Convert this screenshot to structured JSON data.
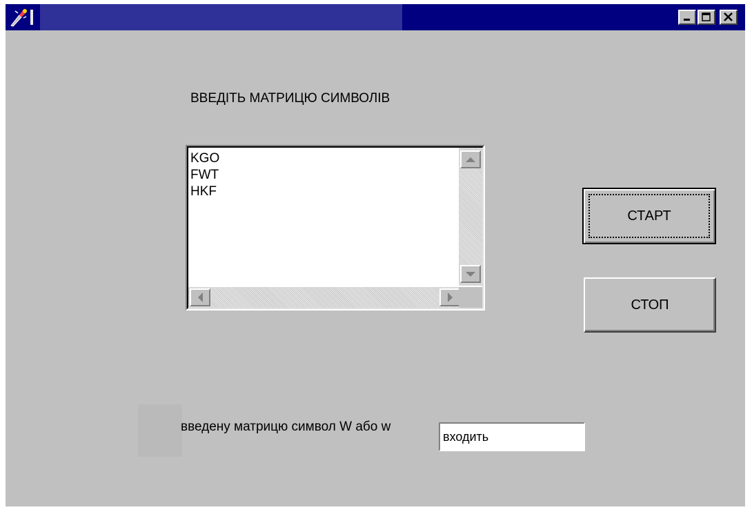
{
  "window": {
    "title": "",
    "controls": {
      "minimize_icon": "minimize-icon",
      "maximize_icon": "maximize-icon",
      "close_icon": "close-icon"
    },
    "colors": {
      "titlebar": "#000080",
      "face": "#c0c0c0"
    }
  },
  "main": {
    "prompt": "ВВЕДІТЬ МАТРИЦЮ СИМВОЛІВ",
    "matrix_lines": [
      "KGO",
      "FWT",
      "HKF"
    ],
    "start_label": "СТАРТ",
    "stop_label": "СТОП",
    "input_label": "введену матрицю символ W або w",
    "input_value": "входить"
  }
}
